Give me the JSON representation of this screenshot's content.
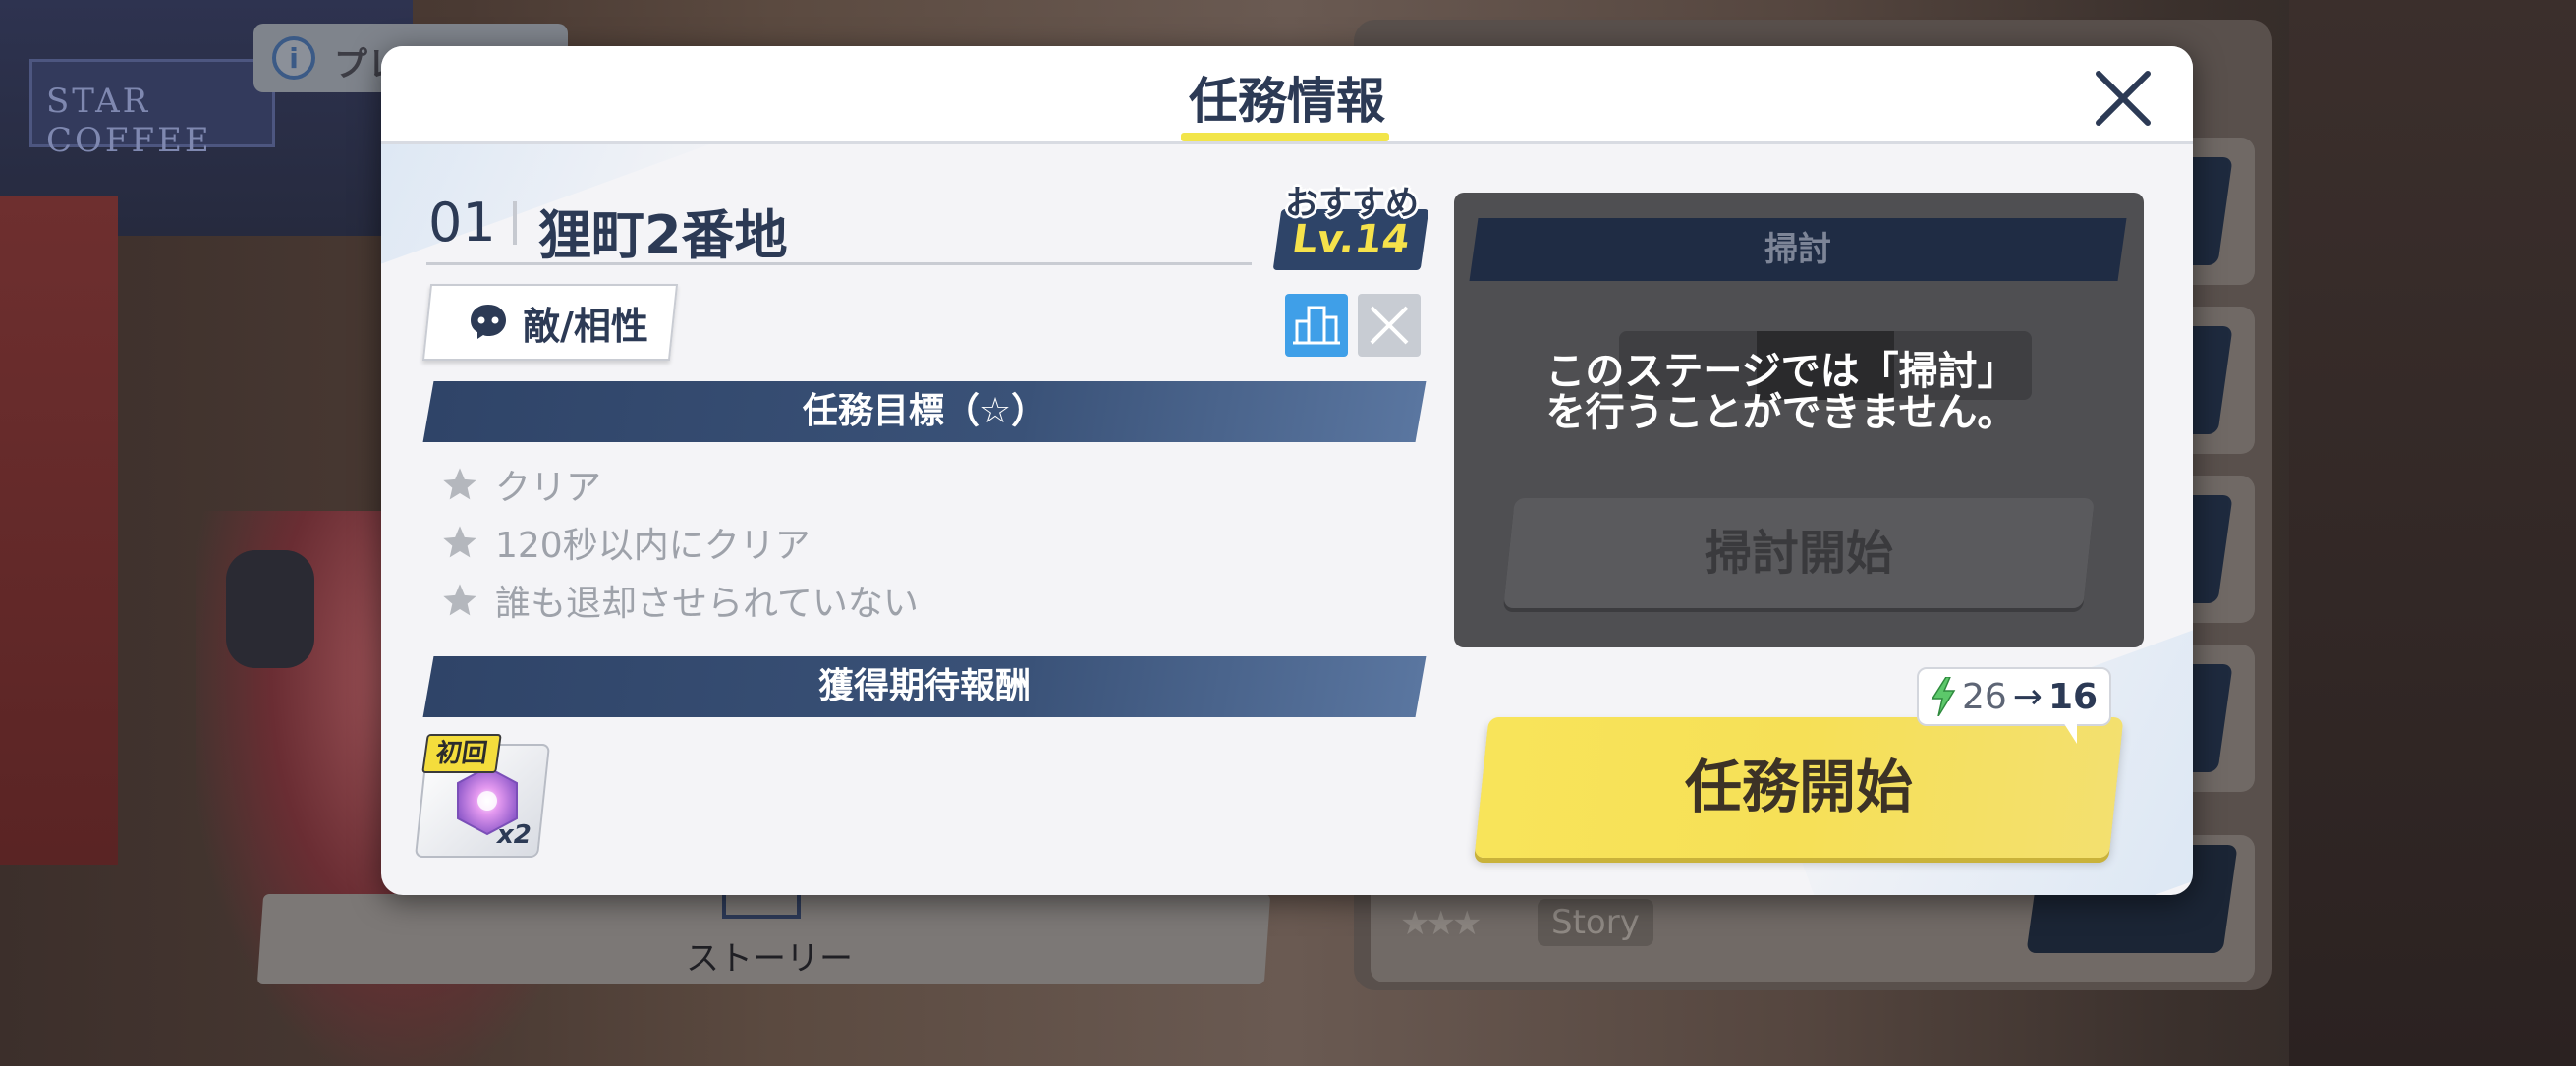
{
  "background": {
    "info_label": "プレ",
    "shop_sign": "STAR COFFEE",
    "story_label": "ストーリー",
    "story_tag": "Story"
  },
  "modal": {
    "title": "任務情報",
    "stage": {
      "number": "01",
      "name": "狸町2番地"
    },
    "recommend": {
      "label": "おすすめ",
      "level": "Lv.14"
    },
    "enemy_button": "敵/相性",
    "objectives": {
      "header": "任務目標（☆）",
      "items": [
        "クリア",
        "120秒以内にクリア",
        "誰も退却させられていない"
      ]
    },
    "rewards": {
      "header": "獲得期待報酬",
      "first_tag": "初回",
      "item_count": "x2"
    },
    "sweep": {
      "header": "掃討",
      "message": "このステージでは「掃討」を行うことができません。",
      "button": "掃討開始"
    },
    "ap": {
      "from": "26",
      "to": "16"
    },
    "start_button": "任務開始"
  },
  "colors": {
    "navy": "#2c3a55",
    "accent_yellow": "#f6e057",
    "blue_icon": "#3f9fe8"
  }
}
